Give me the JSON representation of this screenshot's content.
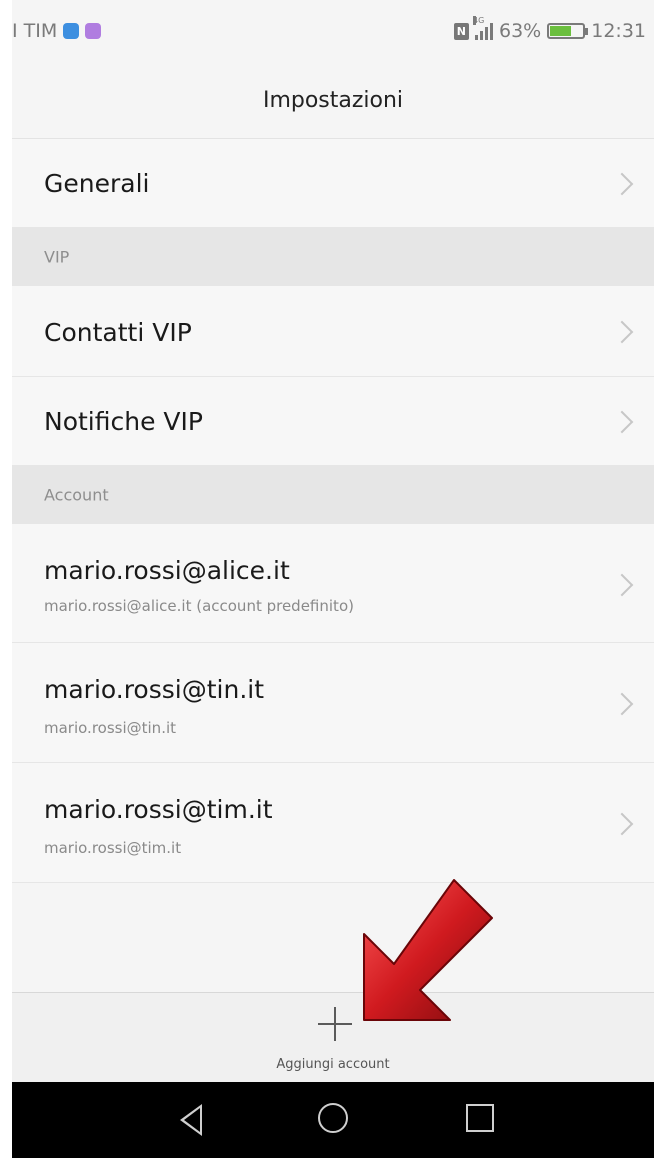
{
  "status_bar": {
    "carrier": "I TIM",
    "battery_percent": "63%",
    "time": "12:31",
    "network": "4G",
    "icons": [
      "app-blue-icon",
      "app-purple-icon",
      "nfc-icon",
      "signal-icon",
      "battery-icon"
    ]
  },
  "header": {
    "title": "Impostazioni"
  },
  "rows": {
    "generali": "Generali",
    "contatti_vip": "Contatti VIP",
    "notifiche_vip": "Notifiche VIP"
  },
  "sections": {
    "vip": "VIP",
    "account": "Account"
  },
  "accounts": [
    {
      "title": "mario.rossi@alice.it",
      "subtitle": "mario.rossi@alice.it (account predefinito)"
    },
    {
      "title": "mario.rossi@tin.it",
      "subtitle": "mario.rossi@tin.it"
    },
    {
      "title": "mario.rossi@tim.it",
      "subtitle": "mario.rossi@tim.it"
    }
  ],
  "bottom": {
    "add_label": "Aggiungi account"
  },
  "colors": {
    "arrow": "#c0161b",
    "battery": "#6bbf3e",
    "app_blue": "#3d8fe0",
    "app_purple": "#b07de0"
  }
}
